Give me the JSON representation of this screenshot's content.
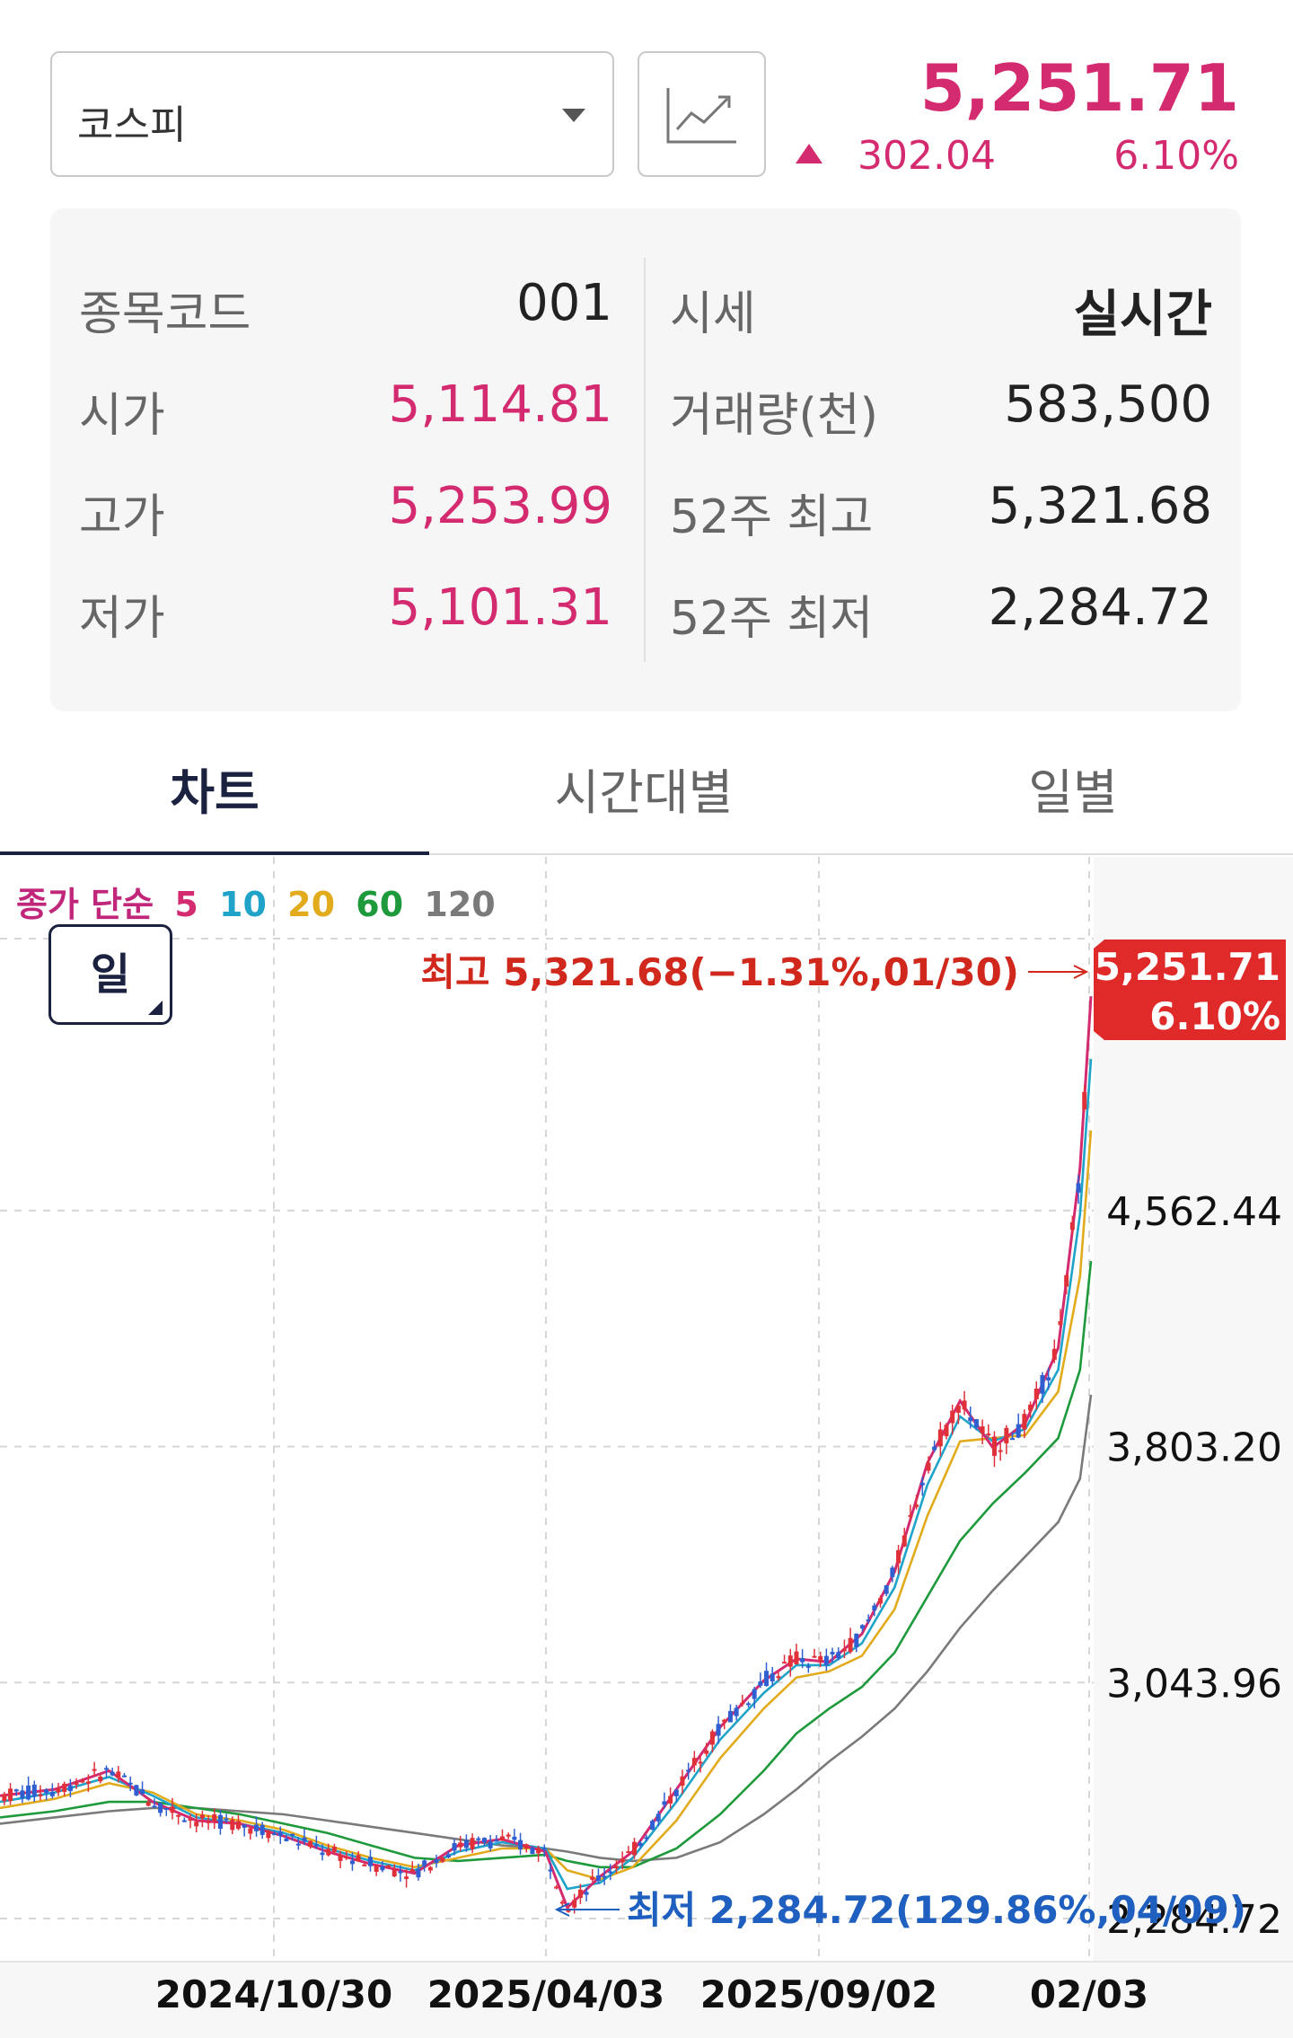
{
  "header": {
    "index_name": "코스피",
    "price": "5,251.71",
    "change_abs": "302.04",
    "change_pct": "6.10%",
    "up_color": "#d42a6f"
  },
  "info": {
    "left": [
      {
        "label": "종목코드",
        "value": "001"
      },
      {
        "label": "시가",
        "value": "5,114.81"
      },
      {
        "label": "고가",
        "value": "5,253.99"
      },
      {
        "label": "저가",
        "value": "5,101.31"
      }
    ],
    "right": [
      {
        "label": "시세",
        "value": "실시간"
      },
      {
        "label": "거래량(천)",
        "value": "583,500"
      },
      {
        "label": "52주 최고",
        "value": "5,321.68"
      },
      {
        "label": "52주 최저",
        "value": "2,284.72"
      }
    ]
  },
  "tabs": [
    {
      "label": "차트",
      "active": true
    },
    {
      "label": "시간대별",
      "active": false
    },
    {
      "label": "일별",
      "active": false
    }
  ],
  "chart_controls": {
    "legend_prefix": "종가 단순",
    "ma_periods": [
      {
        "label": "5",
        "color": "#d42a6f"
      },
      {
        "label": "10",
        "color": "#1fa3c9"
      },
      {
        "label": "20",
        "color": "#e2ab1c"
      },
      {
        "label": "60",
        "color": "#1e9a3c"
      },
      {
        "label": "120",
        "color": "#7a7a7a"
      }
    ],
    "period_button": "일"
  },
  "chart_data": {
    "type": "line",
    "title": "",
    "y_ticks": [
      2284.72,
      3043.96,
      3803.2,
      4562.44
    ],
    "y_tick_labels": [
      "2,284.72",
      "3,043.96",
      "3,803.20",
      "4,562.44"
    ],
    "ylim": [
      2284.72,
      5321.68
    ],
    "x_tick_labels": [
      "2024/10/30",
      "2025/04/03",
      "2025/09/02",
      "02/03"
    ],
    "xlim": [
      "2024/08",
      "2026/02/03"
    ],
    "current_price_label": {
      "price": "5,251.71",
      "pct": "6.10%",
      "color": "#e02a2a"
    },
    "high_annotation": {
      "text": "최고 5,321.68(−1.31%,01/30)",
      "value": 5321.68,
      "date": "01/30",
      "color": "#d0281c"
    },
    "low_annotation": {
      "text": "최저 2,284.72(129.86%,04/09)",
      "value": 2284.72,
      "date": "04/09",
      "color": "#1f5fbf"
    },
    "series": [
      {
        "name": "5",
        "color": "#d42a6f",
        "points": [
          [
            0,
            2680
          ],
          [
            5,
            2700
          ],
          [
            10,
            2760
          ],
          [
            14,
            2660
          ],
          [
            18,
            2600
          ],
          [
            22,
            2590
          ],
          [
            26,
            2550
          ],
          [
            30,
            2500
          ],
          [
            34,
            2460
          ],
          [
            38,
            2430
          ],
          [
            42,
            2520
          ],
          [
            46,
            2540
          ],
          [
            50,
            2500
          ],
          [
            52,
            2320
          ],
          [
            55,
            2420
          ],
          [
            58,
            2500
          ],
          [
            62,
            2700
          ],
          [
            66,
            2900
          ],
          [
            70,
            3050
          ],
          [
            73,
            3120
          ],
          [
            76,
            3110
          ],
          [
            79,
            3200
          ],
          [
            82,
            3400
          ],
          [
            85,
            3750
          ],
          [
            88,
            3950
          ],
          [
            91,
            3800
          ],
          [
            94,
            3880
          ],
          [
            97,
            4120
          ],
          [
            99,
            4700
          ],
          [
            100,
            5251.71
          ]
        ]
      },
      {
        "name": "10",
        "color": "#1fa3c9",
        "points": [
          [
            0,
            2660
          ],
          [
            5,
            2690
          ],
          [
            10,
            2740
          ],
          [
            14,
            2680
          ],
          [
            18,
            2610
          ],
          [
            22,
            2590
          ],
          [
            26,
            2560
          ],
          [
            30,
            2510
          ],
          [
            34,
            2470
          ],
          [
            38,
            2440
          ],
          [
            42,
            2500
          ],
          [
            46,
            2530
          ],
          [
            50,
            2510
          ],
          [
            52,
            2380
          ],
          [
            55,
            2400
          ],
          [
            58,
            2480
          ],
          [
            62,
            2660
          ],
          [
            66,
            2860
          ],
          [
            70,
            3010
          ],
          [
            73,
            3100
          ],
          [
            76,
            3100
          ],
          [
            79,
            3170
          ],
          [
            82,
            3350
          ],
          [
            85,
            3680
          ],
          [
            88,
            3900
          ],
          [
            91,
            3820
          ],
          [
            94,
            3860
          ],
          [
            97,
            4050
          ],
          [
            99,
            4550
          ],
          [
            100,
            5050
          ]
        ]
      },
      {
        "name": "20",
        "color": "#e2ab1c",
        "points": [
          [
            0,
            2640
          ],
          [
            5,
            2670
          ],
          [
            10,
            2720
          ],
          [
            14,
            2690
          ],
          [
            18,
            2620
          ],
          [
            22,
            2600
          ],
          [
            26,
            2570
          ],
          [
            30,
            2520
          ],
          [
            34,
            2480
          ],
          [
            38,
            2450
          ],
          [
            42,
            2480
          ],
          [
            46,
            2510
          ],
          [
            50,
            2510
          ],
          [
            52,
            2440
          ],
          [
            55,
            2410
          ],
          [
            58,
            2450
          ],
          [
            62,
            2600
          ],
          [
            66,
            2800
          ],
          [
            70,
            2960
          ],
          [
            73,
            3060
          ],
          [
            76,
            3080
          ],
          [
            79,
            3130
          ],
          [
            82,
            3280
          ],
          [
            85,
            3580
          ],
          [
            88,
            3820
          ],
          [
            91,
            3830
          ],
          [
            94,
            3840
          ],
          [
            97,
            3980
          ],
          [
            99,
            4350
          ],
          [
            100,
            4820
          ]
        ]
      },
      {
        "name": "60",
        "color": "#1e9a3c",
        "points": [
          [
            0,
            2610
          ],
          [
            5,
            2630
          ],
          [
            10,
            2660
          ],
          [
            14,
            2660
          ],
          [
            18,
            2640
          ],
          [
            22,
            2620
          ],
          [
            26,
            2590
          ],
          [
            30,
            2560
          ],
          [
            34,
            2520
          ],
          [
            38,
            2480
          ],
          [
            42,
            2470
          ],
          [
            46,
            2480
          ],
          [
            50,
            2490
          ],
          [
            52,
            2470
          ],
          [
            55,
            2450
          ],
          [
            58,
            2450
          ],
          [
            62,
            2510
          ],
          [
            66,
            2620
          ],
          [
            70,
            2760
          ],
          [
            73,
            2880
          ],
          [
            76,
            2960
          ],
          [
            79,
            3030
          ],
          [
            82,
            3140
          ],
          [
            85,
            3320
          ],
          [
            88,
            3500
          ],
          [
            91,
            3620
          ],
          [
            94,
            3720
          ],
          [
            97,
            3830
          ],
          [
            99,
            4050
          ],
          [
            100,
            4400
          ]
        ]
      },
      {
        "name": "120",
        "color": "#7a7a7a",
        "points": [
          [
            0,
            2590
          ],
          [
            5,
            2610
          ],
          [
            10,
            2630
          ],
          [
            14,
            2640
          ],
          [
            18,
            2640
          ],
          [
            22,
            2630
          ],
          [
            26,
            2620
          ],
          [
            30,
            2600
          ],
          [
            34,
            2580
          ],
          [
            38,
            2560
          ],
          [
            42,
            2540
          ],
          [
            46,
            2520
          ],
          [
            50,
            2510
          ],
          [
            52,
            2500
          ],
          [
            55,
            2480
          ],
          [
            58,
            2470
          ],
          [
            62,
            2480
          ],
          [
            66,
            2530
          ],
          [
            70,
            2620
          ],
          [
            73,
            2700
          ],
          [
            76,
            2790
          ],
          [
            79,
            2870
          ],
          [
            82,
            2960
          ],
          [
            85,
            3080
          ],
          [
            88,
            3220
          ],
          [
            91,
            3340
          ],
          [
            94,
            3450
          ],
          [
            97,
            3560
          ],
          [
            99,
            3700
          ],
          [
            100,
            3970
          ]
        ]
      }
    ]
  }
}
